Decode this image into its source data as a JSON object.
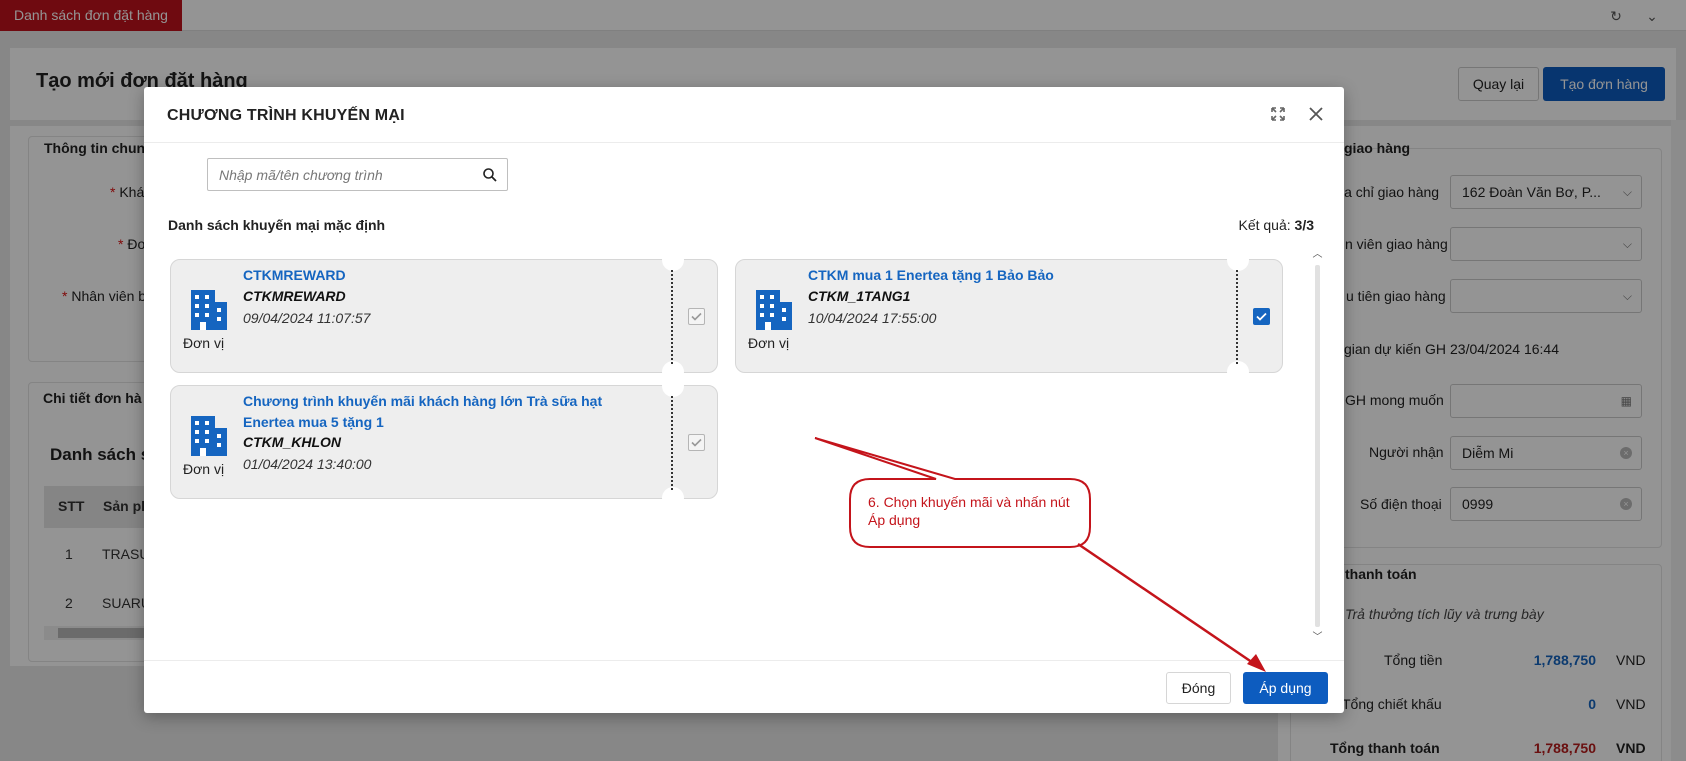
{
  "topbar": {
    "active_tab": "Danh sách đơn đặt hàng"
  },
  "page": {
    "title": "Tạo mới đơn đặt hàng",
    "back_label": "Quay lại",
    "create_label": "Tạo đơn hàng"
  },
  "left": {
    "general_info_title": "Thông tin chun",
    "field_customer": "Khá",
    "field_unit": "Đơ",
    "field_sales": "Nhân viên b",
    "order_detail_title": "Chi tiết đơn hà",
    "product_list_title": "Danh sách s",
    "col_stt": "STT",
    "col_product": "Sản ph",
    "rows": [
      {
        "stt": "1",
        "product": "TRASU"
      },
      {
        "stt": "2",
        "product": "SUARU"
      }
    ]
  },
  "right": {
    "delivery_title": "giao hàng",
    "delivery_address_label": "ịa chỉ giao hàng",
    "delivery_address_value": "162 Đoàn Văn Bơ, P...",
    "delivery_staff_label": "n viên giao hàng",
    "delivery_priority_label": "u tiên giao hàng",
    "expected_time_label": "gian dự kiến GH",
    "expected_time_value": "23/04/2024 16:44",
    "desired_date_label": "GH mong muốn",
    "receiver_label": "Người nhận",
    "receiver_value": "Diễm Mi",
    "phone_label": "Số điện thoại",
    "phone_value": "0999",
    "payment_title": "thanh toán",
    "payment_note": "Trả thưởng tích lũy và trưng bày",
    "total_label": "Tổng tiền",
    "total_value": "1,788,750",
    "discount_label": "Tổng chiết khấu",
    "discount_value": "0",
    "grand_total_label": "Tổng thanh toán",
    "grand_total_value": "1,788,750",
    "currency": "VND"
  },
  "modal": {
    "title": "CHƯƠNG TRÌNH KHUYẾN MẠI",
    "search_placeholder": "Nhập mã/tên chương trình",
    "list_title": "Danh sách khuyến mại mặc định",
    "result_label": "Kết quả:",
    "result_count": "3/3",
    "promotions": [
      {
        "name": "CTKMREWARD",
        "code": "CTKMREWARD",
        "date": "09/04/2024 11:07:57",
        "unit": "Đơn vị",
        "checked": false
      },
      {
        "name": "CTKM mua 1 Enertea tặng 1 Bảo Bảo",
        "code": "CTKM_1TANG1",
        "date": "10/04/2024 17:55:00",
        "unit": "Đơn vị",
        "checked": true
      },
      {
        "name": "Chương trình khuyến mãi khách hàng lớn Trà sữa hạt Enertea mua 5 tặng 1",
        "code": "CTKM_KHLON",
        "date": "01/04/2024 13:40:00",
        "unit": "Đơn vị",
        "checked": false
      }
    ],
    "close_label": "Đóng",
    "apply_label": "Áp dụng"
  },
  "annotation": {
    "text": "6. Chọn khuyến mãi và nhấn nút Áp dụng",
    "color": "#c4141b"
  },
  "colors": {
    "primary": "#0d5cbf",
    "link": "#1565c0",
    "tab_red": "#c0121c",
    "money_blue": "#1565c0",
    "money_red": "#b71c1c"
  }
}
